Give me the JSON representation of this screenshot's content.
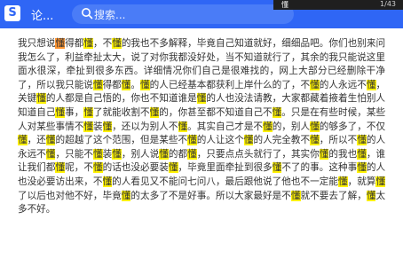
{
  "header": {
    "logo": "S",
    "brand": "论...",
    "search_placeholder": "搜索...",
    "find_term": "懂",
    "find_count": "1/43"
  },
  "colors": {
    "topbar": "#2f66f5",
    "highlight": "#fff200",
    "current_highlight": "#ff9632"
  },
  "icons": {
    "search": "search-icon"
  },
  "article": {
    "highlight": "懂",
    "text": "我只想说懂得都懂，不懂的我也不多解释，毕竟自己知道就好，细细品吧。你们也别来问我怎么了，利益牵扯太大，说了对你我都没好处，当不知道就行了，其余的我只能说这里面水很深，牵扯到很多东西。详细情况你们自己是很难找的，网上大部分已经删除干净了，所以我只能说懂得都懂。懂的人已经基本都获利上岸什么的了，不懂的人永远不懂，关键懂的人都是自己悟的，你也不知道谁是懂的人也没法请教，大家都藏着掖着生怕别人知道自己懂事，懂了就能收割不懂的，你甚至都不知道自己不懂。只是在有些时候，某些人对某些事情不懂装懂，还以为别人不懂。其实自己才是不懂的，别人懂的够多了，不仅懂，还懂的超越了这个范围，但是某些不懂的人让这个懂的人完全教不懂，所以不懂的人永远不懂，只能不懂装懂，别人说懂的都懂，只要点点头就行了，其实你懂的我也懂，谁让我们都懂呢，不懂的话也没必要装懂，毕竟里面牵扯到很多懂不了的事。这种事懂的人也没必要访出来，不懂的人看见又不能问七问八，最后跟他说了他也不一定能懂，就算懂了以后也对他不好，毕竟懂的太多了不是好事。所以大家最好是不懂就不要去了解，懂太多不好。"
  }
}
